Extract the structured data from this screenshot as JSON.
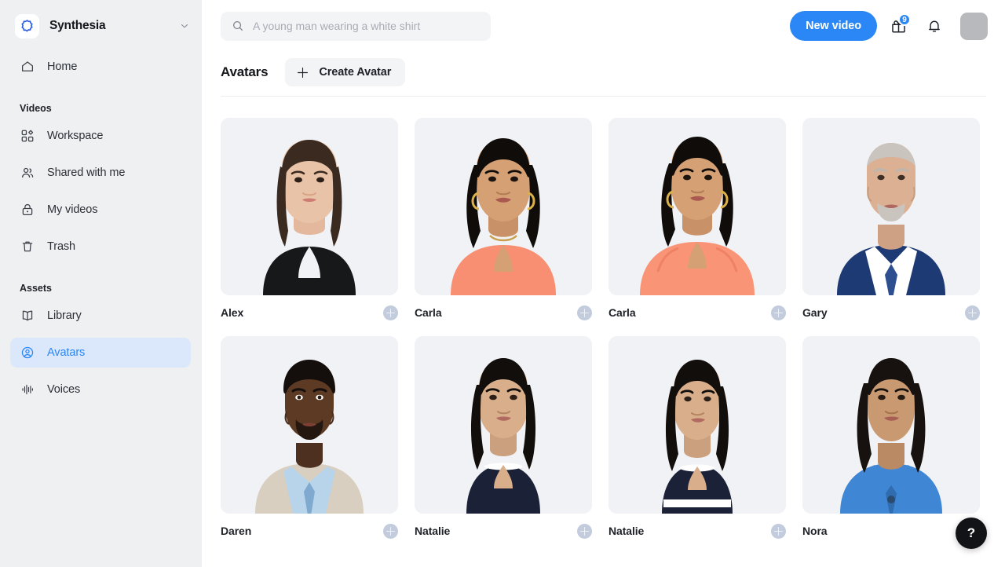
{
  "sidebar": {
    "brand": {
      "name": "Synthesia",
      "logo_icon": "synthesia-logo-icon",
      "caret_icon": "chevron-down-icon"
    },
    "top_items": [
      {
        "label": "Home",
        "icon": "home-icon",
        "active": false
      }
    ],
    "groups": [
      {
        "title": "Videos",
        "items": [
          {
            "label": "Workspace",
            "icon": "grid-squares-icon",
            "active": false
          },
          {
            "label": "Shared with me",
            "icon": "users-icon",
            "active": false
          },
          {
            "label": "My videos",
            "icon": "lock-icon",
            "active": false
          },
          {
            "label": "Trash",
            "icon": "trash-icon",
            "active": false
          }
        ]
      },
      {
        "title": "Assets",
        "items": [
          {
            "label": "Library",
            "icon": "book-icon",
            "active": false
          },
          {
            "label": "Avatars",
            "icon": "user-circle-icon",
            "active": true
          },
          {
            "label": "Voices",
            "icon": "waveform-icon",
            "active": false
          }
        ]
      }
    ]
  },
  "topbar": {
    "search": {
      "placeholder": "A young man wearing a white shirt",
      "value": "",
      "icon": "search-icon"
    },
    "new_video_label": "New video",
    "gift": {
      "icon": "gift-icon",
      "badge": "9"
    },
    "notifications": {
      "icon": "bell-icon"
    },
    "user_avatar": {
      "icon": "avatar"
    }
  },
  "page": {
    "title": "Avatars",
    "create_avatar_label": "Create Avatar",
    "create_avatar_icon": "plus-icon"
  },
  "avatars": [
    {
      "name": "Alex",
      "add_icon": "plus-circle-icon",
      "has_add": true,
      "skin": "#e9c3a8",
      "hair": "#3a2a20",
      "clothes": "#17181a",
      "hair_style": "straight-long",
      "bg": "#f1f2f5"
    },
    {
      "name": "Carla",
      "add_icon": "plus-circle-icon",
      "has_add": true,
      "skin": "#d5a074",
      "hair": "#100c0a",
      "clothes": "#f98f72",
      "hair_style": "wavy-long",
      "bg": "#f1f2f5"
    },
    {
      "name": "Carla",
      "add_icon": "plus-circle-icon",
      "has_add": true,
      "skin": "#d5a074",
      "hair": "#100c0a",
      "clothes": "#fa9477",
      "hair_style": "wavy-long",
      "bg": "#f1f2f5"
    },
    {
      "name": "Gary",
      "add_icon": "plus-circle-icon",
      "has_add": true,
      "skin": "#dcb092",
      "hair": "#c9c4bd",
      "clothes": "#1d3a74",
      "hair_style": "bald",
      "bg": "#f1f2f5"
    },
    {
      "name": "Daren",
      "add_icon": "plus-circle-icon",
      "has_add": true,
      "skin": "#5c3a24",
      "hair": "#140f0c",
      "clothes": "#d9cfc0",
      "hair_style": "short",
      "bg": "#f1f2f5"
    },
    {
      "name": "Natalie",
      "add_icon": "plus-circle-icon",
      "has_add": true,
      "skin": "#d9ae8b",
      "hair": "#120e0c",
      "clothes": "#1b2238",
      "hair_style": "straight-long",
      "bg": "#f1f2f5"
    },
    {
      "name": "Natalie",
      "add_icon": "plus-circle-icon",
      "has_add": true,
      "skin": "#d9ae8b",
      "hair": "#120e0c",
      "clothes": "#1b2238",
      "hair_style": "straight-long",
      "bg": "#f1f2f5"
    },
    {
      "name": "Nora",
      "add_icon": "plus-circle-icon",
      "has_add": false,
      "skin": "#c99a72",
      "hair": "#17120f",
      "clothes": "#3f86d4",
      "hair_style": "straight-long",
      "bg": "#f1f2f5"
    }
  ],
  "help": {
    "label": "?",
    "icon": "question-mark-icon"
  },
  "colors": {
    "accent": "#2b87f5",
    "sidebar_bg": "#eff0f2",
    "active_item_bg": "#dbe7fb",
    "card_bg": "#f1f2f5",
    "text": "#1e2127"
  }
}
